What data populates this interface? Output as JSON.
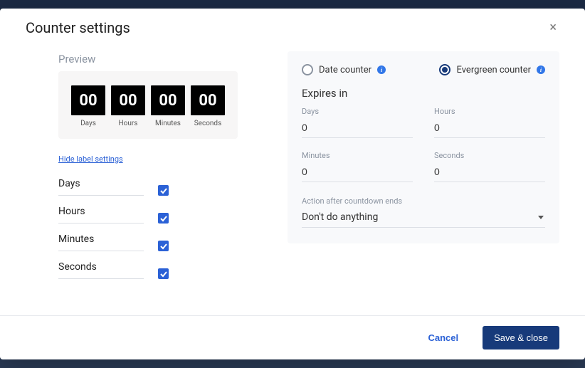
{
  "modal": {
    "title": "Counter settings",
    "close_glyph": "×"
  },
  "preview": {
    "heading": "Preview",
    "ticks": [
      {
        "value": "00",
        "label": "Days"
      },
      {
        "value": "00",
        "label": "Hours"
      },
      {
        "value": "00",
        "label": "Minutes"
      },
      {
        "value": "00",
        "label": "Seconds"
      }
    ]
  },
  "label_settings": {
    "toggle_link": "Hide label settings",
    "rows": [
      {
        "name": "Days",
        "enabled": true
      },
      {
        "name": "Hours",
        "enabled": true
      },
      {
        "name": "Minutes",
        "enabled": true
      },
      {
        "name": "Seconds",
        "enabled": true
      }
    ]
  },
  "counter_type": {
    "options": {
      "date": "Date counter",
      "evergreen": "Evergreen counter"
    },
    "selected": "evergreen",
    "info_glyph": "i"
  },
  "expires": {
    "title": "Expires in",
    "fields": {
      "days": {
        "label": "Days",
        "value": "0"
      },
      "hours": {
        "label": "Hours",
        "value": "0"
      },
      "minutes": {
        "label": "Minutes",
        "value": "0"
      },
      "seconds": {
        "label": "Seconds",
        "value": "0"
      }
    }
  },
  "after_action": {
    "label": "Action after countdown ends",
    "selected": "Don't do anything"
  },
  "footer": {
    "cancel": "Cancel",
    "save": "Save & close"
  }
}
